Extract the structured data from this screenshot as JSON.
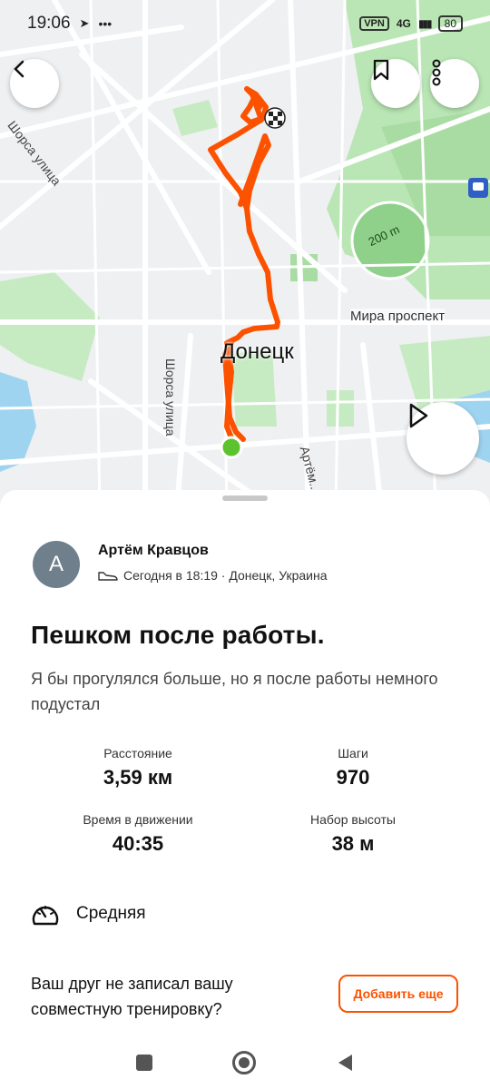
{
  "status_bar": {
    "time": "19:06",
    "vpn": "VPN",
    "network": "4G",
    "battery": "80"
  },
  "map": {
    "labels": {
      "street_left_top": "Шорса улица",
      "street_left_mid": "Шорса улица",
      "avenue": "Мира проспект",
      "city": "Донецк",
      "stadium": "200 m",
      "street_bottom": "Артём..."
    },
    "route_color": "#fc5200",
    "start_marker_color": "#5cc32e"
  },
  "activity": {
    "author": "Артём Кравцов",
    "avatar_initial": "А",
    "meta": "Сегодня в 18:19 · Донецк, Украина",
    "title": "Пешком после работы.",
    "description": "Я бы прогулялся больше, но я после работы немного подустал",
    "stats": [
      {
        "label": "Расстояние",
        "value": "3,59 км"
      },
      {
        "label": "Шаги",
        "value": "970"
      },
      {
        "label": "Время в движении",
        "value": "40:35"
      },
      {
        "label": "Набор высоты",
        "value": "38 м"
      }
    ],
    "intensity": "Средняя"
  },
  "prompt": {
    "text": "Ваш друг не записал вашу совместную тренировку?",
    "button": "Добавить еще"
  },
  "colors": {
    "accent": "#fc5200"
  }
}
